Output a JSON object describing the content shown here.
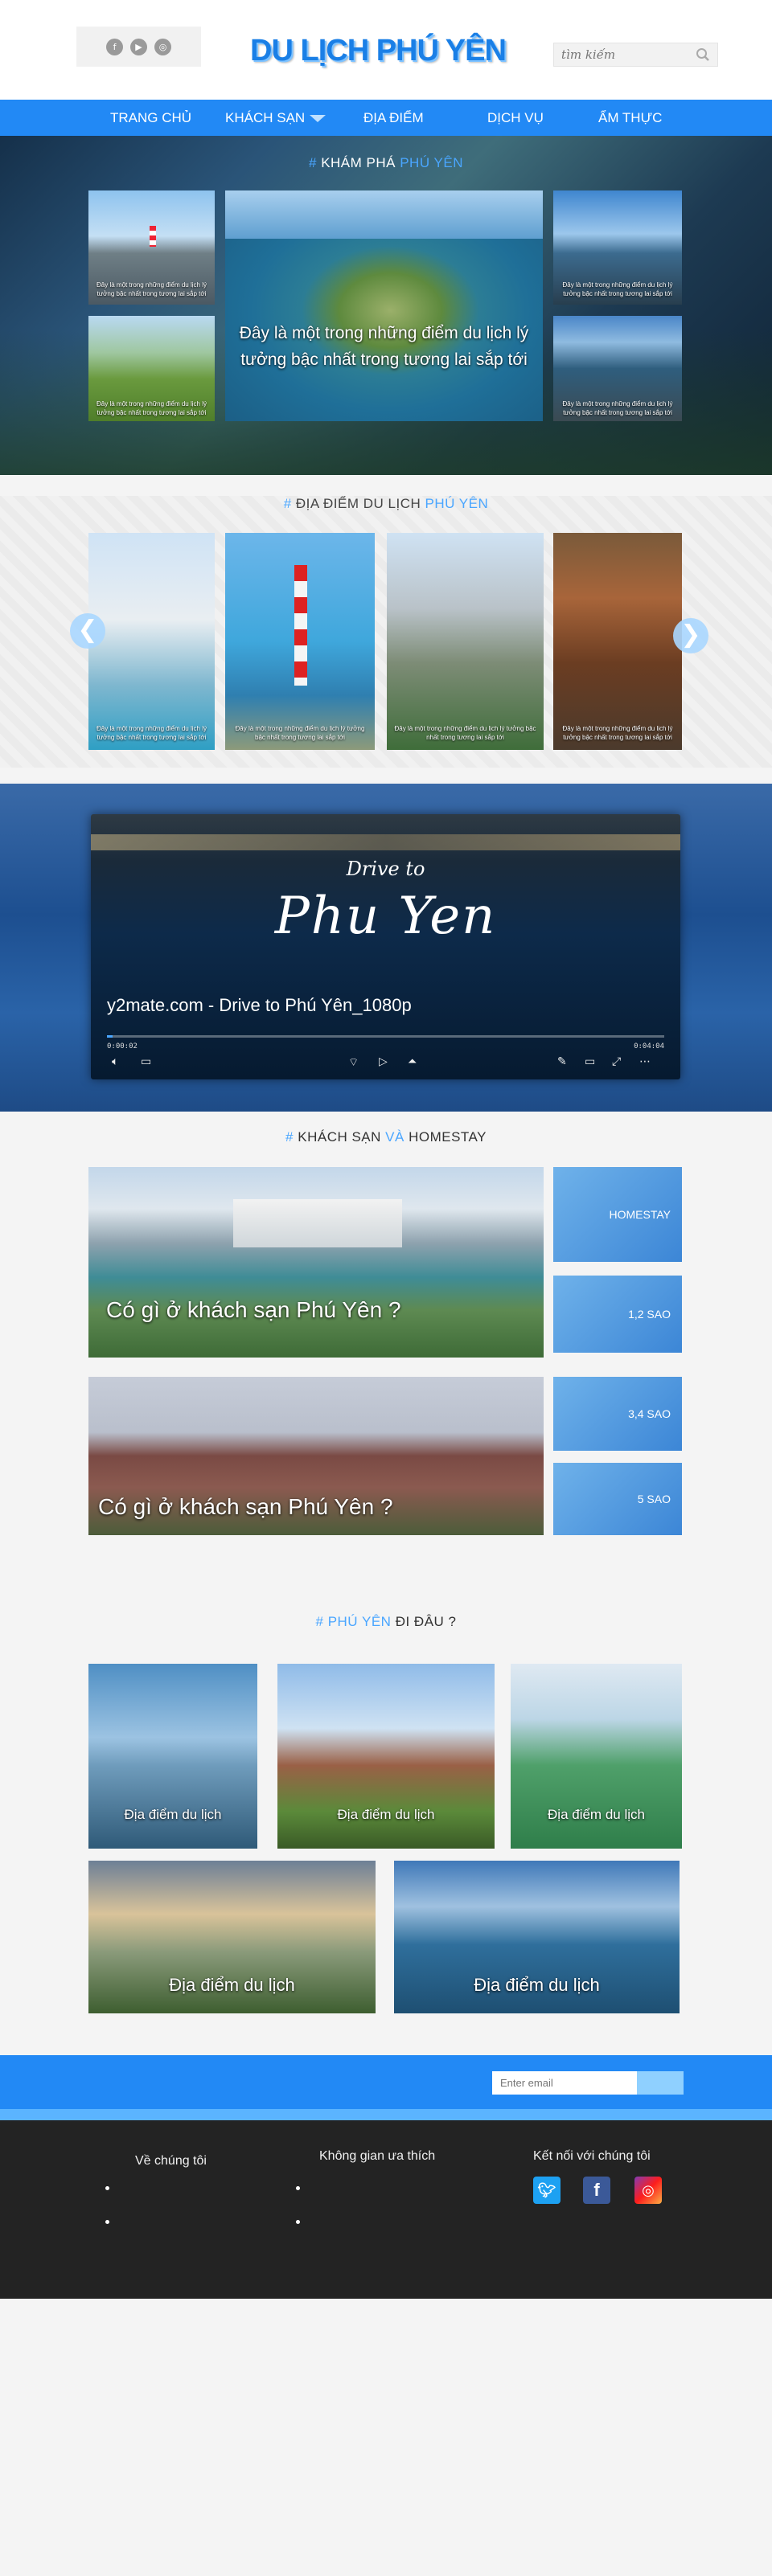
{
  "header": {
    "logo": "DU LỊCH PHÚ YÊN",
    "search_placeholder": "tìm kiếm",
    "social_icons": [
      "facebook-icon",
      "youtube-icon",
      "instagram-icon"
    ]
  },
  "nav": {
    "items": [
      "TRANG CHỦ",
      "KHÁCH SẠN",
      "ĐỊA ĐIỂM",
      "DỊCH VỤ",
      "ẨM THỰC"
    ]
  },
  "explore": {
    "title_prefix": "# ",
    "title_main": "KHÁM PHÁ ",
    "title_highlight": "PHÚ YÊN",
    "small_caption": "Đây là một trong những điểm du lịch lý tưởng bậc nhất trong tương lai sắp tới",
    "big_caption": "Đây là một trong những điểm du lịch lý tưởng bậc nhất trong tương lai sắp tới"
  },
  "places": {
    "title_prefix": "# ",
    "title_main": "ĐỊA ĐIỂM DU LỊCH  ",
    "title_highlight": "PHÚ YÊN",
    "caption": "Đây là một trong những điểm du lịch lý tưởng bậc nhất trong tương lai sắp tới",
    "prev": "❮",
    "next": "❯"
  },
  "video": {
    "title": "y2mate.com - Drive to Phú Yên_1080p",
    "script_top": "Drive to",
    "script_main": "Phu Yen",
    "time_current": "0:00:02",
    "time_total": "0:04:04",
    "progress": 0.01
  },
  "hotels": {
    "title_prefix": "# ",
    "title_main": "KHÁCH SẠN ",
    "title_and": "VÀ ",
    "title_end": "HOMESTAY",
    "card_caption": "Có gì ở khách sạn Phú Yên ?",
    "tiles": [
      "HOMESTAY",
      "1,2 SAO",
      "3,4 SAO",
      "5 SAO"
    ]
  },
  "where": {
    "title_prefix": "# ",
    "title_highlight": "PHÚ YÊN ",
    "title_main": "ĐI ĐÂU ?",
    "caption": "Địa điểm du lịch"
  },
  "newsletter": {
    "placeholder": "Enter email"
  },
  "footer": {
    "col1": "Về chúng tôi",
    "col2": "Không gian ưa thích",
    "col3": "Kết nối với chúng tôi",
    "social": [
      "twitter-icon",
      "facebook-icon",
      "instagram-icon"
    ]
  },
  "colors": {
    "accent": "#2289f5",
    "highlight": "#4aa6ff",
    "footer": "#232323"
  }
}
